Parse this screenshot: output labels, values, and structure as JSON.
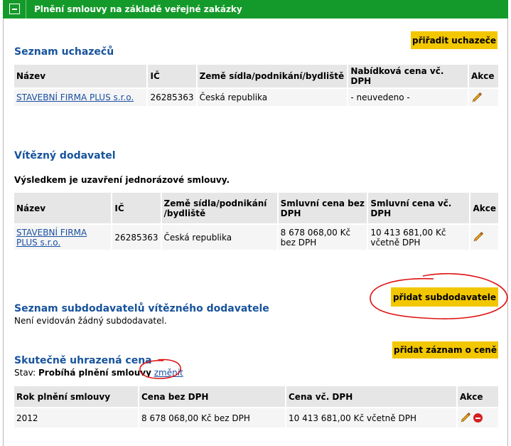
{
  "header": {
    "title": "Plnění smlouvy na základě veřejné zakázky"
  },
  "applicants": {
    "title": "Seznam uchazečů",
    "assign_button": "přiřadit uchazeče",
    "columns": [
      "Název",
      "IČ",
      "Země sídla/podnikání/bydliště",
      "Nabídková cena vč. DPH",
      "Akce"
    ],
    "rows": [
      {
        "name": "STAVEBNÍ FIRMA PLUS s.r.o.",
        "ico": "26285363",
        "country": "Česká republika",
        "price": "- neuvedeno -"
      }
    ]
  },
  "winner": {
    "title": "Vítězný dodavatel",
    "result_text": "Výsledkem je uzavření jednorázové smlouvy.",
    "columns": [
      "Název",
      "IČ",
      "Země sídla/podnikání\n/bydliště",
      "Smluvní cena bez DPH",
      "Smluvní cena vč. DPH",
      "Akce"
    ],
    "rows": [
      {
        "name": "STAVEBNÍ FIRMA PLUS s.r.o.",
        "ico": "26285363",
        "country": "Česká republika",
        "price_no_vat": "8 678 068,00 Kč bez DPH",
        "price_vat": "10 413 681,00 Kč včetně DPH"
      }
    ]
  },
  "subcontractors": {
    "title": "Seznam subdodavatelů vítězného dodavatele",
    "add_button": "přidat subdodavatele",
    "empty_text": "Není evidován žádný subdodavatel."
  },
  "paid_price": {
    "title": "Skutečně uhrazená cena",
    "add_button": "přidat záznam o ceně",
    "status_label": "Stav:",
    "status_value": "Probíhá plnění smlouvy",
    "change_link": "změnit",
    "columns": [
      "Rok plnění smlouvy",
      "Cena bez DPH",
      "Cena vč. DPH",
      "Akce"
    ],
    "rows": [
      {
        "year": "2012",
        "price_no_vat": "8 678 068,00 Kč bez DPH",
        "price_vat": "10 413 681,00 Kč včetně DPH"
      }
    ]
  },
  "icons": {
    "edit": "pencil-icon",
    "delete": "delete-icon",
    "collapse": "collapse-icon"
  },
  "colors": {
    "header_bg": "#149a2a",
    "button_bg": "#f2c700",
    "section_title": "#17539c",
    "annotation": "#e01010"
  }
}
